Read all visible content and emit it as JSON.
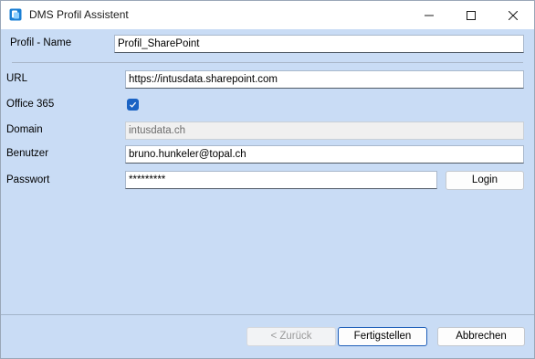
{
  "window": {
    "title": "DMS Profil Assistent",
    "icons": {
      "app": "dms-app-icon",
      "minimize": "minimize-icon",
      "maximize": "maximize-icon",
      "close": "close-icon"
    }
  },
  "form": {
    "profile_name_label": "Profil - Name",
    "profile_name_value": "Profil_SharePoint",
    "url_label": "URL",
    "url_value": "https://intusdata.sharepoint.com",
    "office365_label": "Office 365",
    "office365_checked": true,
    "domain_label": "Domain",
    "domain_value": "intusdata.ch",
    "user_label": "Benutzer",
    "user_value": "bruno.hunkeler@topal.ch",
    "password_label": "Passwort",
    "password_value": "*********",
    "login_label": "Login"
  },
  "footer": {
    "back_label": "< Zurück",
    "finish_label": "Fertigstellen",
    "cancel_label": "Abbrechen"
  },
  "colors": {
    "client_bg": "#c9dcf5",
    "checkbox_accent": "#1a63c4",
    "primary_border": "#1f5fb9"
  }
}
